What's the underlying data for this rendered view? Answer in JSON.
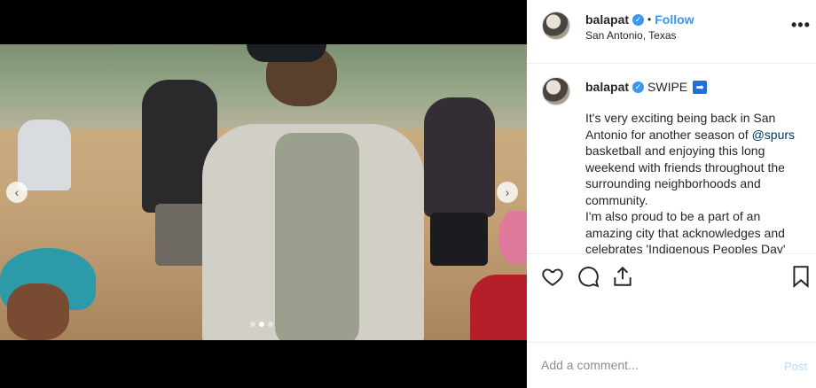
{
  "post": {
    "username": "balapat",
    "separator": "•",
    "follow_label": "Follow",
    "location": "San Antonio, Texas",
    "more_label": "•••"
  },
  "caption": {
    "username": "balapat",
    "swipe": "SWIPE",
    "arrow_emoji": "➡",
    "text_1": "It's very exciting being back in San Antonio for another season of ",
    "mention": "@spurs",
    "text_2": " basketball and enjoying this long weekend with friends throughout the surrounding neighborhoods and community.",
    "text_3": "I'm also proud to be a part of an amazing city that acknowledges and celebrates 'Indigenous Peoples Day'"
  },
  "carousel": {
    "prev_icon": "‹",
    "next_icon": "›",
    "slide_count": 3,
    "active_slide": 2
  },
  "comment": {
    "placeholder": "Add a comment...",
    "post_label": "Post"
  },
  "colors": {
    "accent": "#3897f0",
    "post_disabled": "#b2dffc",
    "text": "#262626"
  }
}
